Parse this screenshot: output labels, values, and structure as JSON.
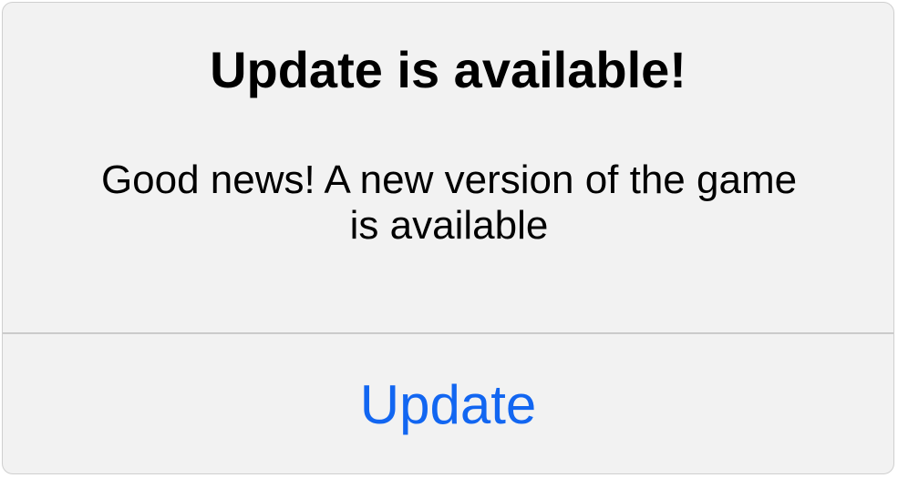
{
  "dialog": {
    "title": "Update is available!",
    "message": "Good news! A new version of the game is available",
    "button_label": "Update"
  },
  "colors": {
    "background": "#f2f2f2",
    "button_text": "#1266f1",
    "divider": "#cbcbcb"
  }
}
